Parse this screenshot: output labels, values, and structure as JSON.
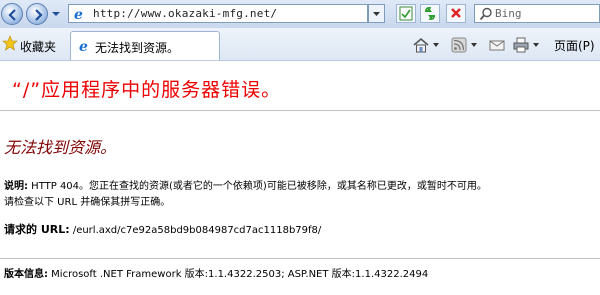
{
  "browser": {
    "address_url": "http://www.okazaki-mfg.net/",
    "search_placeholder": "Bing",
    "favorites_label": "收藏夹",
    "tab_title": "无法找到资源。",
    "page_menu_label": "页面(P)"
  },
  "error_page": {
    "heading": "“/”应用程序中的服务器错误。",
    "subheading": "无法找到资源。",
    "description_label": "说明:",
    "description_text": " HTTP 404。您正在查找的资源(或者它的一个依赖项)可能已被移除，或其名称已更改，或暂时不可用。",
    "description_line2": "请检查以下 URL 并确保其拼写正确。",
    "requested_url_label": "请求的 URL:",
    "requested_url": " /eurl.axd/c7e92a58bd9b084987cd7ac1118b79f8/",
    "version_label": "版本信息:",
    "version_text": " Microsoft .NET Framework 版本:1.1.4322.2503; ASP.NET 版本:1.1.4322.2494"
  },
  "colors": {
    "heading": "#ee0000",
    "subheading": "#800000"
  }
}
